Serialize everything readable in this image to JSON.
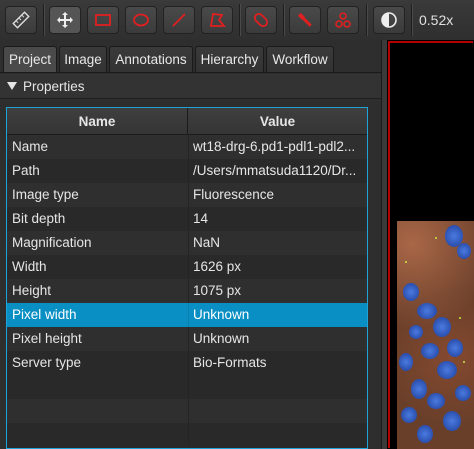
{
  "toolbar": {
    "zoom": "0.52x",
    "icons": [
      "ruler-icon",
      "move-icon",
      "rectangle-icon",
      "ellipse-icon",
      "line-icon",
      "polygon-icon",
      "brush-icon",
      "wand-icon",
      "points-icon",
      "contrast-icon"
    ],
    "accent_color": "#e02020"
  },
  "tabs": [
    {
      "label": "Project"
    },
    {
      "label": "Image"
    },
    {
      "label": "Annotations"
    },
    {
      "label": "Hierarchy"
    },
    {
      "label": "Workflow"
    }
  ],
  "properties": {
    "header": "Properties",
    "columns": {
      "name": "Name",
      "value": "Value"
    },
    "rows": [
      {
        "name": "Name",
        "value": "wt18-drg-6.pd1-pdl1-pdl2..."
      },
      {
        "name": "Path",
        "value": "/Users/mmatsuda1120/Dr..."
      },
      {
        "name": "Image type",
        "value": "Fluorescence"
      },
      {
        "name": "Bit depth",
        "value": "14"
      },
      {
        "name": "Magnification",
        "value": "NaN"
      },
      {
        "name": "Width",
        "value": "1626 px"
      },
      {
        "name": "Height",
        "value": "1075 px"
      },
      {
        "name": "Pixel width",
        "value": "Unknown"
      },
      {
        "name": "Pixel height",
        "value": "Unknown"
      },
      {
        "name": "Server type",
        "value": "Bio-Formats"
      }
    ],
    "selected_row": "Pixel width",
    "selection_color": "#0a8fc4"
  }
}
